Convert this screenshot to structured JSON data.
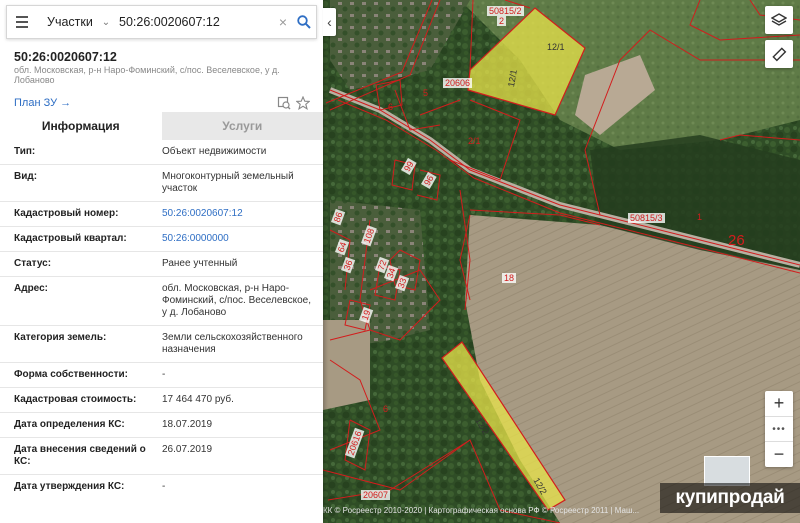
{
  "search": {
    "layer": "Участки",
    "query": "50:26:0020607:12"
  },
  "object": {
    "title": "50:26:0020607:12",
    "address_short": "обл. Московская, р-н Наро-Фоминский, с/пос. Веселевское, у д. Лобаново",
    "plan_link": "План ЗУ"
  },
  "tabs": [
    {
      "label": "Информация"
    },
    {
      "label": "Услуги"
    }
  ],
  "info": [
    {
      "label": "Тип:",
      "value": "Объект недвижимости"
    },
    {
      "label": "Вид:",
      "value": "Многоконтурный земельный участок"
    },
    {
      "label": "Кадастровый номер:",
      "value": "50:26:0020607:12"
    },
    {
      "label": "Кадастровый квартал:",
      "value": "50:26:0000000"
    },
    {
      "label": "Статус:",
      "value": "Ранее учтенный"
    },
    {
      "label": "Адрес:",
      "value": "обл. Московская, р-н Наро-Фоминский, с/пос. Веселевское, у д. Лобаново"
    },
    {
      "label": "Категория земель:",
      "value": "Земли сельскохозяйственного назначения"
    },
    {
      "label": "Форма собственности:",
      "value": "-"
    },
    {
      "label": "Кадастровая стоимость:",
      "value": "17 464 470 руб."
    },
    {
      "label": "Дата определения КС:",
      "value": "18.07.2019"
    },
    {
      "label": "Дата внесения сведений о КС:",
      "value": "26.07.2019"
    },
    {
      "label": "Дата утверждения КС:",
      "value": "-"
    }
  ],
  "map": {
    "labels": {
      "p50815_2": "50815/2",
      "p2": "2",
      "p12_1a": "12/1",
      "p12_1b": "12/1",
      "p20606": "20606",
      "p5": "5",
      "p6a": "6",
      "p2_1": "2/1",
      "p50815_3": "50815/3",
      "p1": "1",
      "p26": "26",
      "p18": "18",
      "p12_2a": "12/2",
      "p12_2b": "12/2",
      "p6b": "6",
      "p20607": "20607",
      "p20616": "20616",
      "p99": "99",
      "p96": "96",
      "p86": "86",
      "p108": "108",
      "p64": "64",
      "p36": "36",
      "p72": "72",
      "p33": "33",
      "p34": "34",
      "p19": "19"
    },
    "copyright": "КК © Росреестр 2010-2020 | Картографическая основа РФ © Росреестр 2011 | Маш...",
    "watermark": "купипродай"
  },
  "colors": {
    "link": "#2e6ec4",
    "boundary": "#d21d1d",
    "highlight": "#e8e34a"
  }
}
